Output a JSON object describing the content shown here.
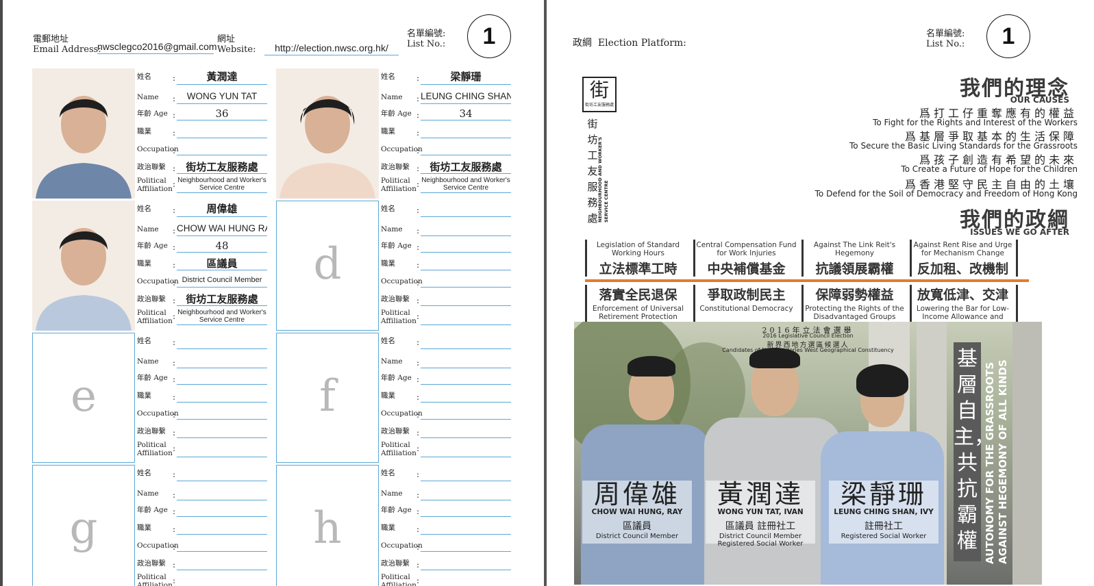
{
  "header": {
    "email_label_zh": "電郵地址",
    "email_label_en": "Email Address:",
    "email_value": "nwsclegco2016@gmail.com",
    "website_label_zh": "網址",
    "website_label_en": "Website:",
    "website_value": "http://election.nwsc.org.hk/",
    "listno_label_zh": "名單編號:",
    "listno_label_en": "List No.:",
    "listno_value": "1"
  },
  "field_labels": {
    "name_zh": "姓名",
    "name_en": "Name",
    "age": "年齡 Age",
    "occupation_zh": "職業",
    "occupation_en": "Occupation",
    "affiliation_zh": "政治聯繫",
    "affiliation_en_1": "Political",
    "affiliation_en_2": "Affiliation",
    "colon": ":"
  },
  "candidates": [
    {
      "name_zh": "黃潤達",
      "name_en": "WONG YUN TAT",
      "age": "36",
      "occupation_zh": "",
      "occupation_en": "",
      "affiliation_zh": "街坊工友服務處",
      "affiliation_en": "Neighbourhood and Worker's Service Centre",
      "placeholder": ""
    },
    {
      "name_zh": "梁靜珊",
      "name_en": "LEUNG CHING SHAN",
      "age": "34",
      "occupation_zh": "",
      "occupation_en": "",
      "affiliation_zh": "街坊工友服務處",
      "affiliation_en": "Neighbourhood and Worker's Service Centre",
      "placeholder": ""
    },
    {
      "name_zh": "周偉雄",
      "name_en": "CHOW WAI HUNG RAYMAN",
      "age": "48",
      "occupation_zh": "區議員",
      "occupation_en": "District Council Member",
      "affiliation_zh": "街坊工友服務處",
      "affiliation_en": "Neighbourhood and Worker's Service Centre",
      "placeholder": ""
    },
    {
      "name_zh": "",
      "name_en": "",
      "age": "",
      "occupation_zh": "",
      "occupation_en": "",
      "affiliation_zh": "",
      "affiliation_en": "",
      "placeholder": "d"
    },
    {
      "name_zh": "",
      "name_en": "",
      "age": "",
      "occupation_zh": "",
      "occupation_en": "",
      "affiliation_zh": "",
      "affiliation_en": "",
      "placeholder": "e"
    },
    {
      "name_zh": "",
      "name_en": "",
      "age": "",
      "occupation_zh": "",
      "occupation_en": "",
      "affiliation_zh": "",
      "affiliation_en": "",
      "placeholder": "f"
    },
    {
      "name_zh": "",
      "name_en": "",
      "age": "",
      "occupation_zh": "",
      "occupation_en": "",
      "affiliation_zh": "",
      "affiliation_en": "",
      "placeholder": "g"
    },
    {
      "name_zh": "",
      "name_en": "",
      "age": "",
      "occupation_zh": "",
      "occupation_en": "",
      "affiliation_zh": "",
      "affiliation_en": "",
      "placeholder": "h"
    }
  ],
  "platform": {
    "label_zh": "政綱",
    "label_en": "Election Platform:",
    "logo_char": "街",
    "logo_small": "街坊工友服務處",
    "org_vertical_zh": "街坊工友服務處",
    "org_vertical_en": "NEIGHBOURHOOD AND WORKER'S SERVICE CENTRE",
    "causes_title_zh": "我們的理念",
    "causes_title_en": "OUR CAUSES",
    "causes": [
      {
        "zh": "爲打工仔重奪應有的權益",
        "en": "To Fight for the Rights and Interest of the Workers"
      },
      {
        "zh": "爲基層爭取基本的生活保障",
        "en": "To Secure the Basic Living Standards for the Grassroots"
      },
      {
        "zh": "爲孩子創造有希望的未來",
        "en": "To Create a Future of Hope for the Children"
      },
      {
        "zh": "爲香港堅守民主自由的土壤",
        "en": "To Defend for the Soil of Democracy and Freedom of Hong Kong"
      }
    ],
    "issues_title_zh": "我們的政綱",
    "issues_title_en": "ISSUES WE GO AFTER",
    "issues_row1": [
      {
        "en": "Legislation of Standard Working Hours",
        "zh": "立法標準工時"
      },
      {
        "en": "Central Compensation Fund for Work Injuries",
        "zh": "中央補償基金"
      },
      {
        "en": "Against The Link Reit's Hegemony",
        "zh": "抗議領展霸權"
      },
      {
        "en": "Against Rent Rise and Urge for Mechanism Change",
        "zh": "反加租、改機制"
      }
    ],
    "issues_row2": [
      {
        "zh": "落實全民退保",
        "en": "Enforcement of Universal Retirement Protection"
      },
      {
        "zh": "爭取政制民主",
        "en": "Constitutional Democracy"
      },
      {
        "zh": "保障弱勢權益",
        "en": "Protecting the Rights of the Disadvantaged Groups"
      },
      {
        "zh": "放寬低津、交津",
        "en": "Lowering the Bar for Low-Income Allowance and Transport Subsidy"
      }
    ]
  },
  "poster": {
    "line1": "2016年立法會選舉",
    "line2": "2016 Legislative Council Election",
    "line3": "新界西地方選區候選人",
    "line4": "Candidates of New Territories West Geographical Constituency",
    "people": [
      {
        "name_zh": "周偉雄",
        "name_en": "CHOW WAI HUNG, RAY",
        "role_zh": "區議員",
        "role_en": "District Council Member",
        "role_en_2": ""
      },
      {
        "name_zh": "黃潤達",
        "name_en": "WONG YUN TAT, IVAN",
        "role_zh": "區議員 註冊社工",
        "role_en": "District Council Member",
        "role_en_2": "Registered Social Worker"
      },
      {
        "name_zh": "梁靜珊",
        "name_en": "LEUNG CHING SHAN, IVY",
        "role_zh": "註冊社工",
        "role_en": "Registered Social Worker",
        "role_en_2": ""
      }
    ],
    "slogan_zh": "基層自主，共抗霸權",
    "slogan_en": "AUTONOMY FOR THE GRASSROOTS AGAINST HEGEMONY OF ALL KINDS"
  }
}
